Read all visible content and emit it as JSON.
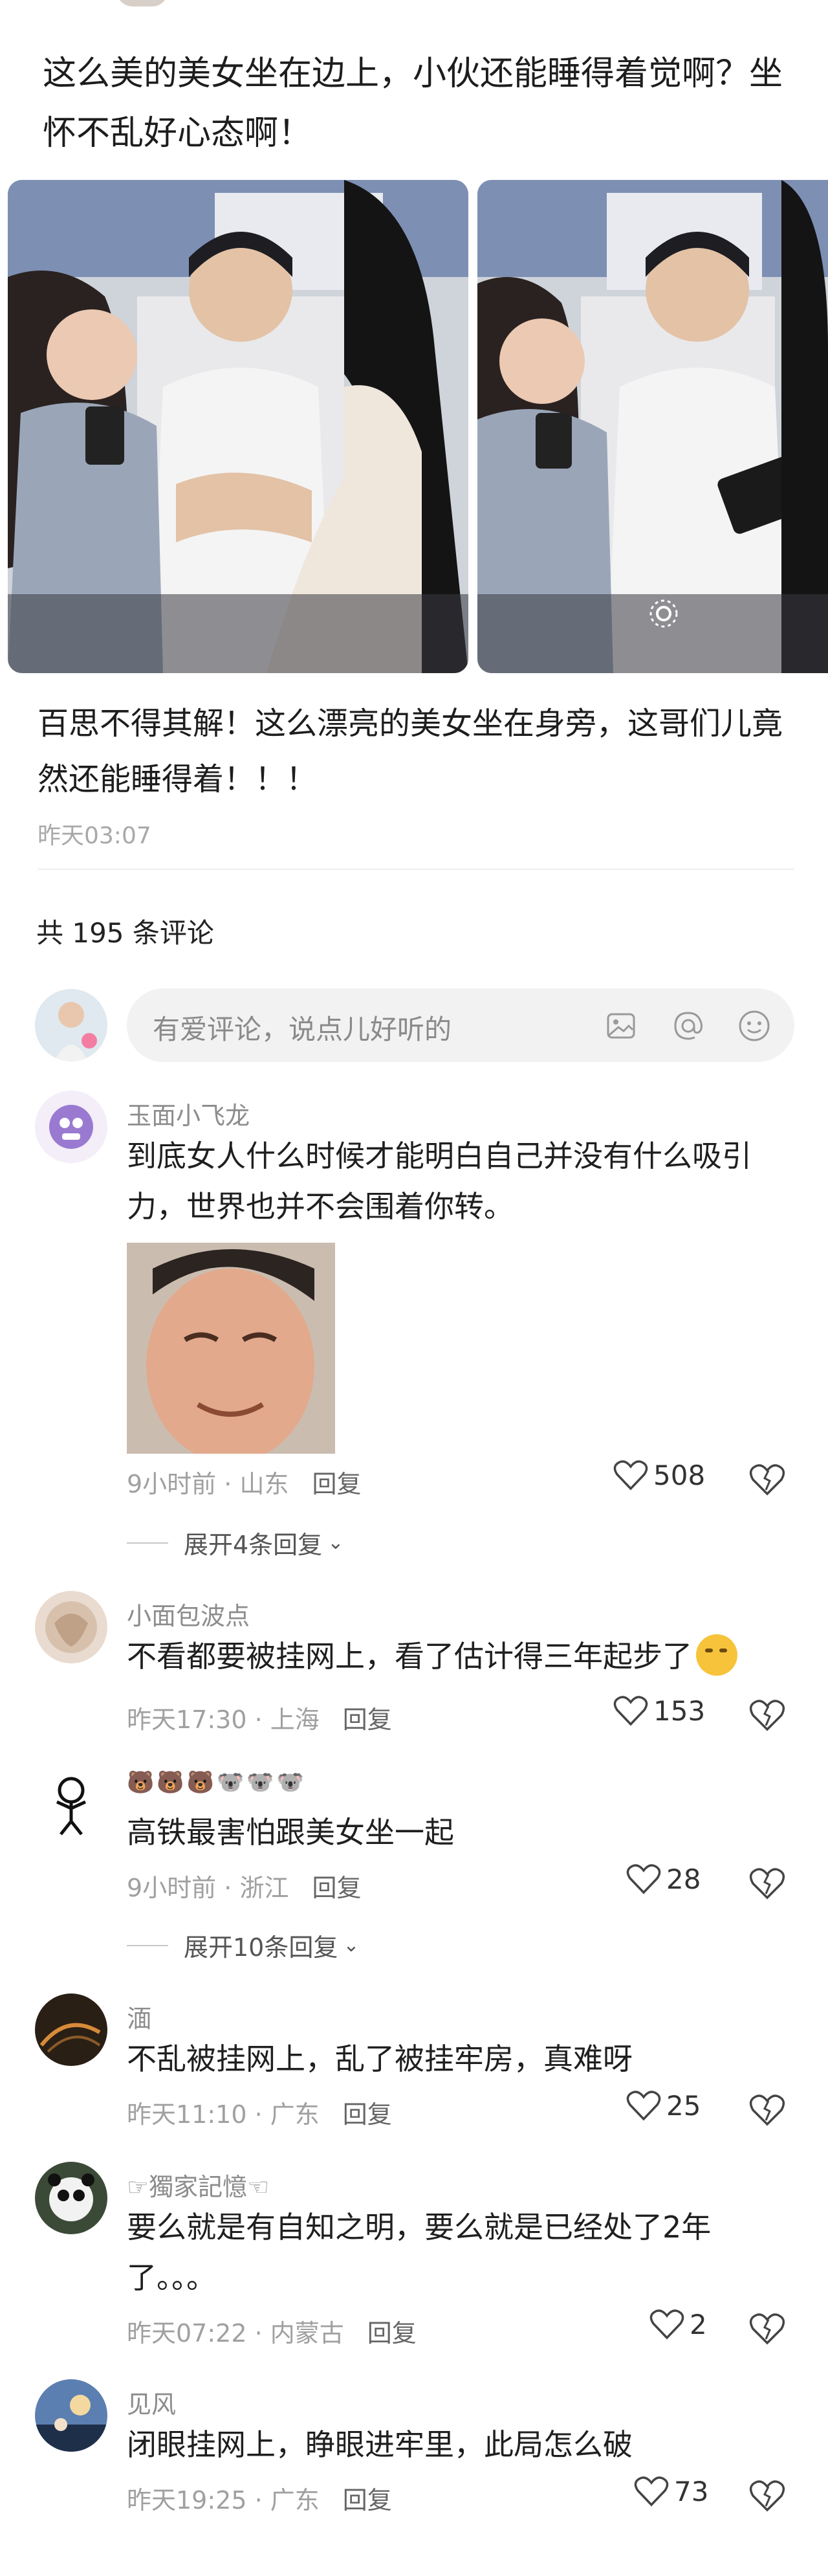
{
  "post": {
    "title": "这么美的美女坐在边上，小伙还能睡得着觉啊？坐怀不乱好心态啊！",
    "body": "百思不得其解！这么漂亮的美女坐在身旁，这哥们儿竟然还能睡得着！！！",
    "time": "昨天03:07"
  },
  "comments_header": {
    "count_text": "共 195 条评论",
    "input_placeholder": "有爱评论，说点儿好听的",
    "icons": [
      "image-icon",
      "at-icon",
      "emoji-icon"
    ]
  },
  "comments": [
    {
      "name": "玉面小飞龙",
      "text": "到底女人什么时候才能明白自己并没有什么吸引力，世界也并不会围着你转。",
      "time": "9小时前",
      "location": "山东",
      "reply": "回复",
      "likes": "508",
      "expand": "展开4条回复"
    },
    {
      "name": "小面包波点",
      "text": "不看都要被挂网上，看了估计得三年起步了",
      "time": "昨天17:30",
      "location": "上海",
      "reply": "回复",
      "likes": "153"
    },
    {
      "name": "🐻🐻🐻🐨🐨🐨",
      "text": "高铁最害怕跟美女坐一起",
      "time": "9小时前",
      "location": "浙江",
      "reply": "回复",
      "likes": "28",
      "expand": "展开10条回复"
    },
    {
      "name": "湎",
      "text": "不乱被挂网上，乱了被挂牢房，真难呀",
      "time": "昨天11:10",
      "location": "广东",
      "reply": "回复",
      "likes": "25"
    },
    {
      "name": "☞獨家記憶☜",
      "text": "要么就是有自知之明，要么就是已经处了2年了。。。",
      "time": "昨天07:22",
      "location": "内蒙古",
      "reply": "回复",
      "likes": "2"
    },
    {
      "name": "见风",
      "text": "闭眼挂网上，睁眼进牢里，此局怎么破",
      "time": "昨天19:25",
      "location": "广东",
      "reply": "回复",
      "likes": "73"
    }
  ],
  "colors": {
    "accent": "#f2f2f2",
    "meta": "#a0a0a0",
    "name": "#8c8c8c"
  }
}
